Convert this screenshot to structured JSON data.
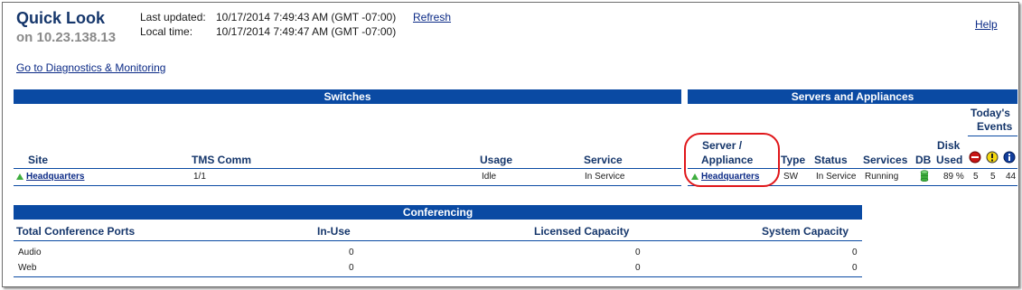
{
  "header": {
    "title": "Quick Look",
    "subtitle": "on 10.23.138.13",
    "last_updated_label": "Last updated:",
    "last_updated_value": "10/17/2014 7:49:43 AM (GMT -07:00)",
    "refresh_label": "Refresh",
    "local_time_label": "Local time:",
    "local_time_value": "10/17/2014 7:49:47 AM (GMT -07:00)",
    "help_label": "Help",
    "diagnostics_link": "Go to Diagnostics & Monitoring"
  },
  "switches": {
    "title": "Switches",
    "columns": {
      "site": "Site",
      "tms_comm": "TMS Comm",
      "usage": "Usage",
      "service": "Service"
    },
    "rows": [
      {
        "site": "Headquarters",
        "tms_comm": "1/1",
        "usage": "Idle",
        "service": "In Service"
      }
    ]
  },
  "servers": {
    "title": "Servers and Appliances",
    "todays_events_line1": "Today's",
    "todays_events_line2": "Events",
    "columns": {
      "server_line1": "Server /",
      "server_line2": "Appliance",
      "type": "Type",
      "status": "Status",
      "services": "Services",
      "db": "DB",
      "disk_line1": "Disk",
      "disk_line2": "Used"
    },
    "rows": [
      {
        "server": "Headquarters",
        "type": "SW",
        "status": "In Service",
        "services": "Running",
        "disk_used": "89 %",
        "events_critical": "5",
        "events_warning": "5",
        "events_info": "44"
      }
    ]
  },
  "conferencing": {
    "title": "Conferencing",
    "columns": {
      "ports": "Total Conference Ports",
      "in_use": "In-Use",
      "licensed": "Licensed Capacity",
      "system": "System Capacity"
    },
    "rows": [
      {
        "ports": "Audio",
        "in_use": "0",
        "licensed": "0",
        "system": "0"
      },
      {
        "ports": "Web",
        "in_use": "0",
        "licensed": "0",
        "system": "0"
      }
    ]
  },
  "colors": {
    "accent_bar": "#0a4aa3",
    "header_text": "#15366b",
    "highlight_circle": "#e0161a",
    "status_up": "#3fae3f"
  }
}
